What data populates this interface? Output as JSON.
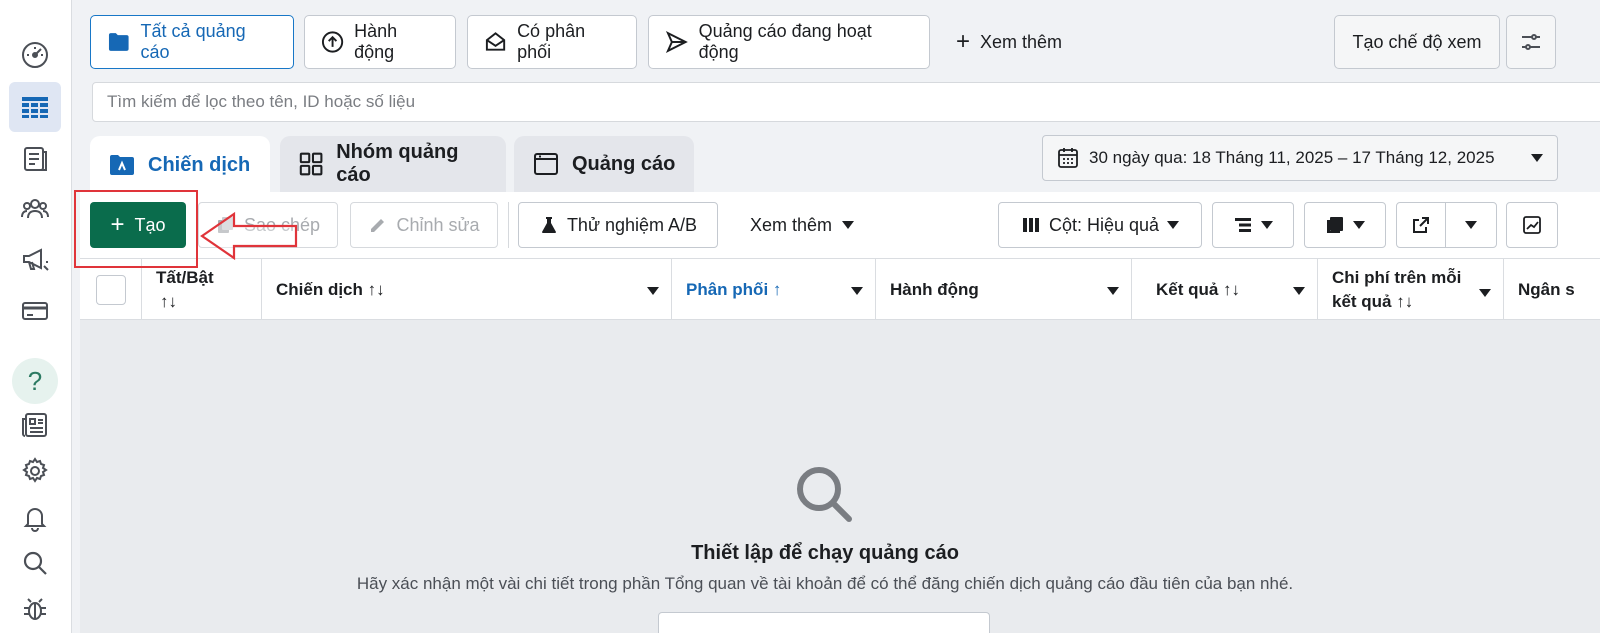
{
  "sidebar": {
    "items": [
      {
        "icon": "dashboard-icon"
      },
      {
        "icon": "table-icon",
        "active": true
      },
      {
        "icon": "catalog-icon"
      },
      {
        "icon": "audience-icon"
      },
      {
        "icon": "megaphone-icon"
      },
      {
        "icon": "billing-card-icon"
      },
      {
        "icon": "help-icon",
        "label": "?"
      },
      {
        "icon": "news-icon"
      },
      {
        "icon": "gear-icon"
      },
      {
        "icon": "bell-icon"
      },
      {
        "icon": "search-icon"
      },
      {
        "icon": "bug-icon"
      }
    ]
  },
  "filters": {
    "all_ads": "Tất cả quảng cáo",
    "actions": "Hành động",
    "delivering": "Có phân phối",
    "active_ads": "Quảng cáo đang hoạt động",
    "see_more": "Xem thêm",
    "create_view": "Tạo chế độ xem"
  },
  "search": {
    "placeholder": "Tìm kiếm để lọc theo tên, ID hoặc số liệu"
  },
  "tabs": {
    "campaigns": "Chiến dịch",
    "ad_sets": "Nhóm quảng cáo",
    "ads": "Quảng cáo"
  },
  "date_range": "30 ngày qua: 18 Tháng 11, 2025 – 17 Tháng 12, 2025",
  "toolbar": {
    "create": "Tạo",
    "duplicate": "Sao chép",
    "edit": "Chỉnh sửa",
    "ab_test": "Thử nghiệm A/B",
    "see_more": "Xem thêm",
    "columns": "Cột: Hiệu quả"
  },
  "table": {
    "headers": {
      "toggle": "Tất/Bật",
      "toggle_sort": "↑↓",
      "campaign": "Chiến dịch ↑↓",
      "delivery": "Phân phối ↑",
      "actions": "Hành động",
      "results": "Kết quả ↑↓",
      "cost_per_result_1": "Chi phí trên mỗi",
      "cost_per_result_2": "kết quả ↑↓",
      "budget": "Ngân s"
    }
  },
  "empty_state": {
    "title": "Thiết lập để chạy quảng cáo",
    "description": "Hãy xác nhận một vài chi tiết trong phần Tổng quan về tài khoản để có thể đăng chiến dịch quảng cáo đầu tiên của bạn nhé."
  },
  "colors": {
    "primary_blue": "#1668b5",
    "create_green": "#0a6c4c",
    "annotation_red": "#e0343a"
  }
}
